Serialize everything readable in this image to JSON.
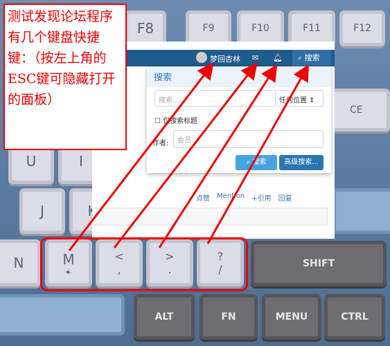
{
  "keyboard": {
    "f8": "F8",
    "f9": "F9",
    "f10": "F10",
    "f11": "F11",
    "f12": "F12",
    "backspace": "CE",
    "u": "U",
    "i": "I",
    "j": "J",
    "k": "K",
    "n": "N",
    "m": "M",
    "comma_top": "<",
    "comma": ",",
    "period_top": ">",
    "period": ".",
    "slash_top": "?",
    "slash": "/",
    "shift": "SHIFT",
    "alt": "ALT",
    "fn": "FN",
    "menu": "MENU",
    "ctrl": "CTRL"
  },
  "forum": {
    "header": {
      "username": "梦回杏林",
      "mail_icon": "envelope-icon",
      "bell_icon": "bell-icon",
      "search_label": "搜索"
    },
    "panel": {
      "title": "搜索",
      "search_placeholder": "搜索...",
      "scope": "任何位置",
      "title_only": "仅搜索标题",
      "author_label": "作者:",
      "author_placeholder": "会员",
      "search_button": "搜索",
      "advanced_button": "高级搜索..."
    },
    "actions": {
      "like": "点赞",
      "mention": "Mention",
      "quote": "+引用",
      "reply": "回复"
    }
  },
  "annotation": {
    "text": "测试发现论坛程序有几个键盘快捷键：（按左上角的ESC键可隐藏打开的面板）",
    "color": "#ee0000"
  }
}
